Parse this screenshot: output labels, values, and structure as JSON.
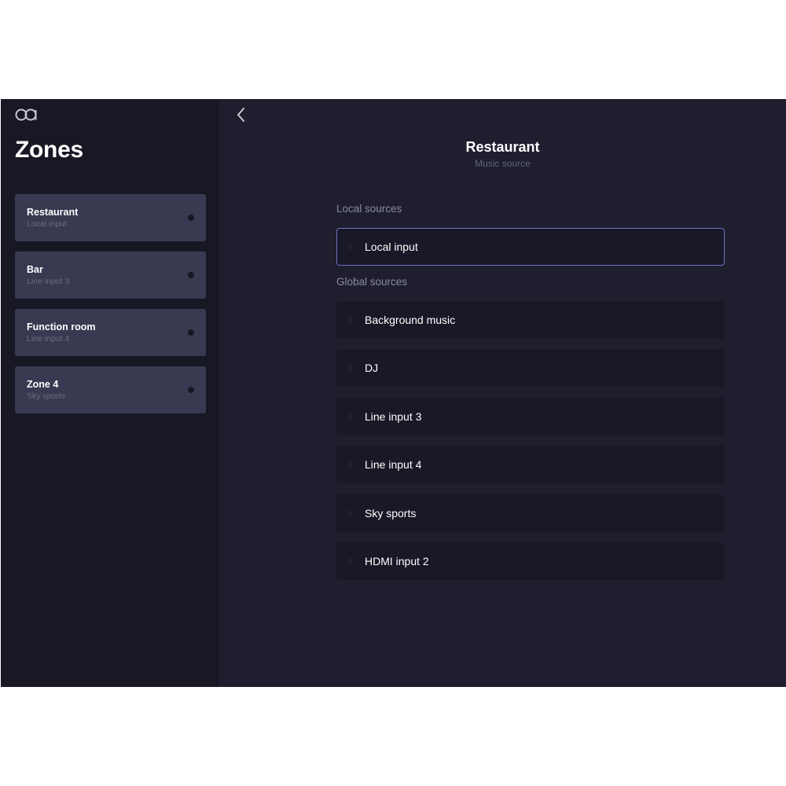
{
  "sidebar": {
    "logo_icon": "oa-logo-icon",
    "title": "Zones",
    "zones": [
      {
        "name": "Restaurant",
        "source": "Local input"
      },
      {
        "name": "Bar",
        "source": "Line input 3"
      },
      {
        "name": "Function room",
        "source": "Line input 4"
      },
      {
        "name": "Zone 4",
        "source": "Sky sports"
      }
    ]
  },
  "main": {
    "back_icon": "chevron-left-icon",
    "title": "Restaurant",
    "subtitle": "Music source",
    "local_sources_label": "Local sources",
    "local_sources": [
      {
        "label": "Local input",
        "selected": true
      }
    ],
    "global_sources_label": "Global sources",
    "global_sources": [
      {
        "label": "Background music"
      },
      {
        "label": "DJ"
      },
      {
        "label": "Line input 3"
      },
      {
        "label": "Line input 4"
      },
      {
        "label": "Sky sports"
      },
      {
        "label": "HDMI input 2"
      }
    ]
  },
  "colors": {
    "background": "#1f1e2e",
    "sidebar": "#181825",
    "zone_card": "#393951",
    "source_item": "#181826",
    "selected_border": "#6d72c3",
    "text_primary": "#ffffff",
    "text_muted": "#8a8aa2"
  }
}
